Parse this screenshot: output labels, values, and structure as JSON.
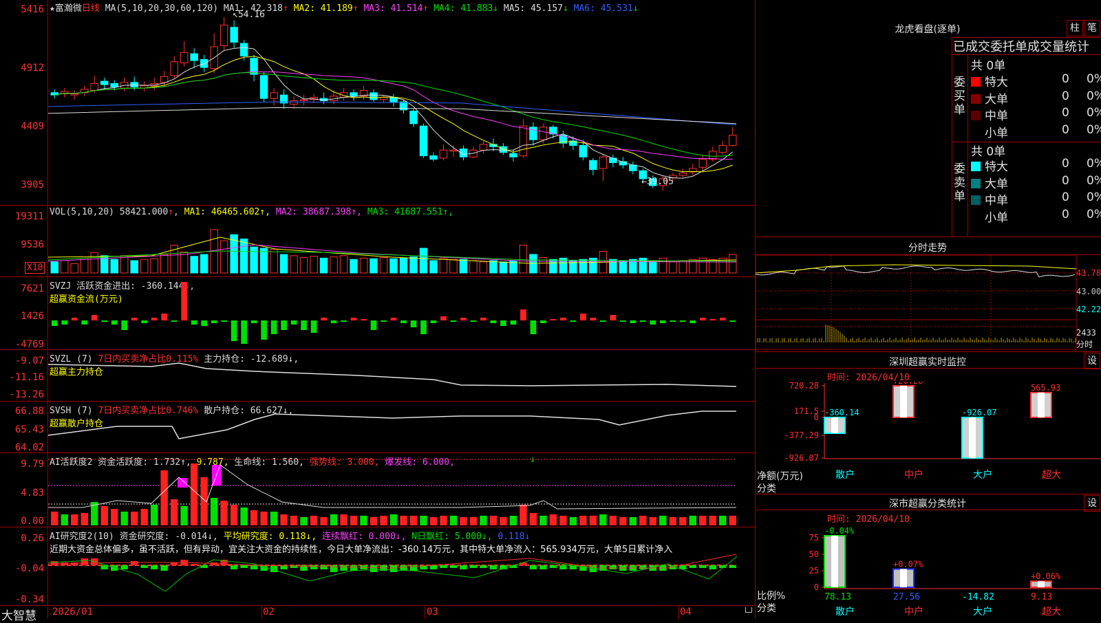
{
  "stock": {
    "star": "★",
    "name": "富瀚微",
    "period": "日线",
    "ma_label": "MA(5,10,20,30,60,120)",
    "ma": [
      {
        "label": "MA1:",
        "value": "42.318",
        "arrow": "↑",
        "color": "#dcdcdc"
      },
      {
        "label": "MA2:",
        "value": "41.189",
        "arrow": "↑",
        "color": "#ffff00"
      },
      {
        "label": "MA3:",
        "value": "41.514",
        "arrow": "↑",
        "color": "#ff40ff"
      },
      {
        "label": "MA4:",
        "value": "41.883",
        "arrow": "↓",
        "color": "#00e000"
      },
      {
        "label": "MA5:",
        "value": "45.157",
        "arrow": "↓",
        "color": "#dcdcdc"
      },
      {
        "label": "MA6:",
        "value": "45.531",
        "arrow": "↓",
        "color": "#3060ff"
      }
    ],
    "high_mark": "54.16",
    "low_mark": "39.05"
  },
  "price_axis": [
    "5416",
    "4912",
    "4409",
    "3905"
  ],
  "vol": {
    "label": "VOL(5,10,20)",
    "value": "58421.000",
    "arrow": "↑",
    "ma": [
      {
        "t": "MA1: ",
        "v": "46465.602↑",
        "color": "#ffff00"
      },
      {
        "t": "MA2: ",
        "v": "38687.398↑",
        "color": "#ff40ff"
      },
      {
        "t": "MA3: ",
        "v": "41687.551↑",
        "color": "#00e000"
      }
    ],
    "axis": [
      "19311",
      "9536"
    ],
    "unit": "X10"
  },
  "svzj": {
    "label": "SVZJ  活跃资金进出: ",
    "value": "-360.144↓",
    "sub": "超赢资金流(万元)",
    "axis": [
      "7621",
      "1426",
      "-4769"
    ]
  },
  "svzl": {
    "label": "SVZL (7) ",
    "red": "7日内买卖净占比0.115%",
    "rest": " 主力持仓: -12.689↓,",
    "sub": "超赢主力持仓",
    "axis": [
      "-9.07",
      "-11.16",
      "-13.26"
    ]
  },
  "svsh": {
    "label": "SVSH (7) ",
    "red": "7日内买卖净占比0.746%",
    "rest": " 散户持仓: 66.627↓,",
    "sub": "超赢散户持仓",
    "axis": [
      "66.88",
      "65.43",
      "64.02"
    ]
  },
  "ai1": {
    "label": "AI活跃度2 资金活跃度: 1.732↑, ",
    "v2": "9.787,",
    "l3": " 生命线: 1.560, ",
    "l4": "强势线: 3.000, ",
    "l5": "爆发线: 6.000,",
    "axis": [
      "9.79",
      "4.83",
      "0.00"
    ]
  },
  "ai2": {
    "label": "AI研究度2(10) 资金研究度: -0.014↓, ",
    "l2": "平均研究度: 0.118↓, ",
    "l3": "连续飘红: 0.000↓, ",
    "l4": "N日飘红: 5.000↓, ",
    "l5": "0.118↓",
    "axis": [
      "0.26",
      "-0.04",
      "-0.34"
    ],
    "comment": "近期大资金总体偏多，虽不活跃，但有异动，宜关注大资金的持续性，今日大单净流出：-360.14万元，其中特大单净流入：565.934万元，大单5日累计净入"
  },
  "bottom": {
    "brand": "大智慧",
    "dates": [
      "2026/01",
      "02",
      "03",
      "04"
    ]
  },
  "dragon": {
    "title": "龙虎看盘(逐单)",
    "btn1": "柱",
    "btn2": "笔",
    "header": "已成交委托单成交量统计",
    "buy": {
      "label": "委买单",
      "total": "共 0单",
      "rows": [
        {
          "name": "特大",
          "n": "0",
          "p": "0%",
          "color": "#ff0000"
        },
        {
          "name": "大单",
          "n": "0",
          "p": "0%",
          "color": "#8a0000"
        },
        {
          "name": "中单",
          "n": "0",
          "p": "0%",
          "color": "#5a0000"
        },
        {
          "name": "小单",
          "n": "0",
          "p": "0%",
          "color": "#000000"
        }
      ]
    },
    "sell": {
      "label": "委卖单",
      "total": "共 0单",
      "rows": [
        {
          "name": "特大",
          "n": "0",
          "p": "0%",
          "color": "#00ffff"
        },
        {
          "name": "大单",
          "n": "0",
          "p": "0%",
          "color": "#008080"
        },
        {
          "name": "中单",
          "n": "0",
          "p": "0%",
          "color": "#006060"
        },
        {
          "name": "小单",
          "n": "0",
          "p": "0%",
          "color": "#000000"
        }
      ]
    }
  },
  "intraday": {
    "title": "分时走势",
    "axis": [
      "43.78",
      "43.00",
      "42.22"
    ],
    "vol_axis": "2433",
    "vol_unit": "分时"
  },
  "sz_monitor": {
    "title": "深圳超赢实时监控",
    "btn": "设",
    "time": "时间: 2026/04/10",
    "ylabel": "净额(万元)",
    "xlabel": "分类",
    "axis": [
      "720.28",
      "171.5",
      "0",
      "-377.29",
      "-926.07"
    ],
    "categories": [
      "散户",
      "中户",
      "大户",
      "超大"
    ],
    "values": [
      -360.14,
      720.28,
      -926.07,
      565.93
    ],
    "labels": [
      "-360.14",
      "720.28",
      "-926.07",
      "565.93"
    ]
  },
  "sz_class": {
    "title": "深市超赢分类统计",
    "btn": "设",
    "time": "时间: 2026/04/10",
    "ylabel": "比例%",
    "xlabel": "分类",
    "axis": [
      "75",
      "50",
      "25",
      "0"
    ],
    "categories": [
      "散户",
      "中户",
      "大户",
      "超大"
    ],
    "values": [
      78.13,
      27.56,
      -14.82,
      9.13
    ],
    "top_labels": [
      "-0.04%",
      "+0.07%",
      "",
      "+0.06%"
    ],
    "bottom_labels": [
      "78.13",
      "27.56",
      "-14.82",
      "9.13"
    ]
  }
}
